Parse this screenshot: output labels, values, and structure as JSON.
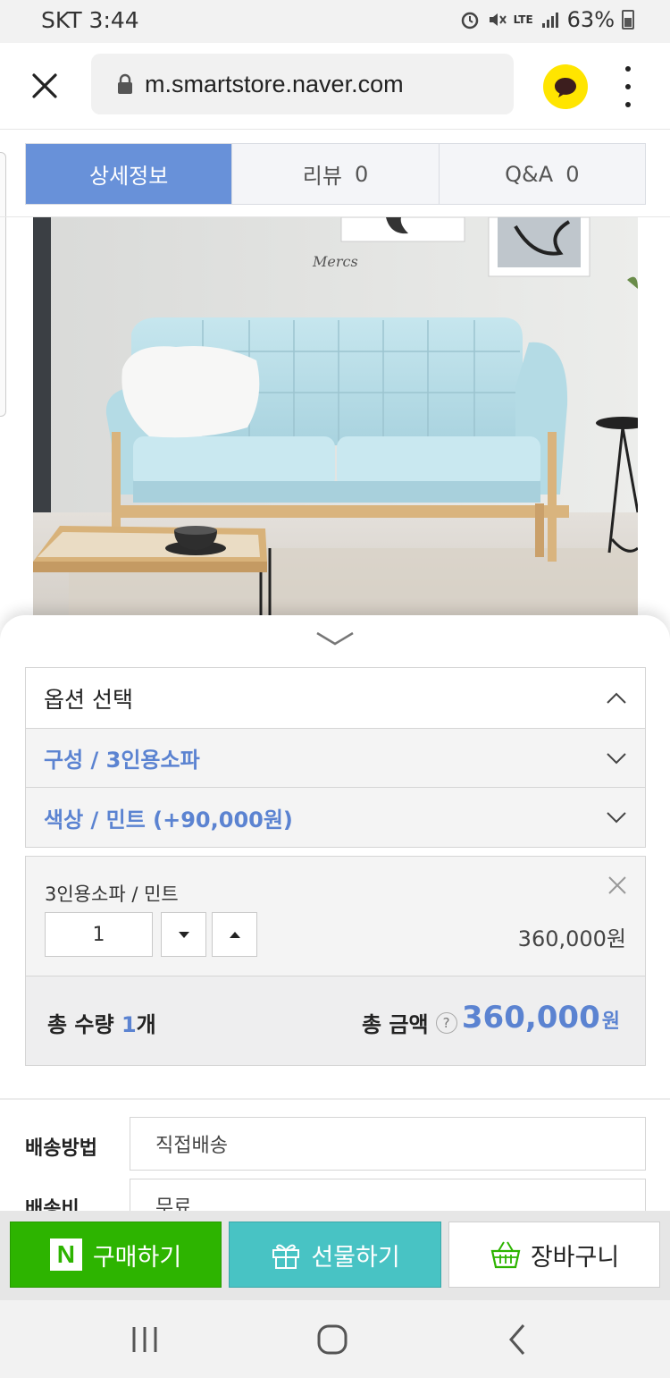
{
  "status_bar": {
    "carrier_time": "SKT 3:44",
    "network": "LTE",
    "battery": "63%"
  },
  "browser": {
    "url": "m.smartstore.naver.com"
  },
  "tabs": [
    {
      "label": "상세정보",
      "count": ""
    },
    {
      "label": "리뷰",
      "count": "0"
    },
    {
      "label": "Q&A",
      "count": "0"
    }
  ],
  "product_image": {
    "wall_text": "Mercs"
  },
  "options": {
    "header": "옵션 선택",
    "rows": [
      {
        "label": "구성 / 3인용소파"
      },
      {
        "label": "색상 / 민트 (+90,000원)"
      }
    ]
  },
  "selected_item": {
    "name": "3인용소파 / 민트",
    "quantity": "1",
    "price": "360,000원"
  },
  "totals": {
    "qty_label": "총 수량",
    "qty_value": "1",
    "qty_unit": "개",
    "amount_label": "총 금액",
    "help": "?",
    "amount_value": "360,000",
    "amount_unit": "원"
  },
  "shipping": {
    "method_label": "배송방법",
    "method_value": "직접배송",
    "fee_label": "배송비",
    "fee_value": "무료"
  },
  "buy_bar": {
    "purchase": "구매하기",
    "purchase_badge": "N",
    "gift": "선물하기",
    "cart": "장바구니"
  },
  "colors": {
    "accent_blue": "#6891d9",
    "naver_green": "#2db400",
    "gift_teal": "#48c3c4"
  }
}
